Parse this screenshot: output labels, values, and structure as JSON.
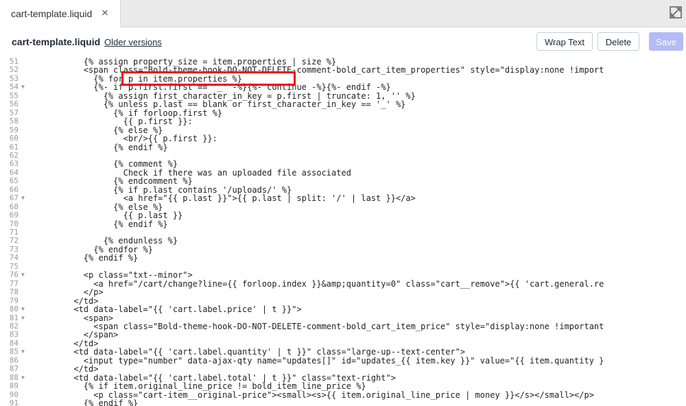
{
  "tab": {
    "label": "cart-template.liquid",
    "close": "×"
  },
  "toolbar": {
    "filename": "cart-template.liquid",
    "older_versions": "Older versions",
    "wrap_text": "Wrap Text",
    "delete": "Delete",
    "save": "Save"
  },
  "icons": {
    "close": "close-icon",
    "expand": "expand-icon",
    "fold": "fold-arrow-icon"
  },
  "colors": {
    "keyword": "#7a1ba7",
    "variable": "#1a2080",
    "string": "#1a7a1a",
    "highlight": "#e00",
    "save_disabled": "#b3bcf5"
  },
  "lines": [
    {
      "n": "51",
      "fold": false,
      "code": "        {% assign property_size = item.properties | size %}"
    },
    {
      "n": "52",
      "fold": false,
      "code": "        <span class=\"Bold-theme-hook-DO-NOT-DELETE-comment-bold_cart_item_properties\" style=\"display:none !import"
    },
    {
      "n": "53",
      "fold": false,
      "code": "          {% for p in item.properties %}"
    },
    {
      "n": "54",
      "fold": true,
      "code": "          {%- if p.first.first == '_' -%}{%- continue -%}{%- endif -%}"
    },
    {
      "n": "55",
      "fold": false,
      "code": "            {% assign first_character_in_key = p.first | truncate: 1, '' %}"
    },
    {
      "n": "56",
      "fold": false,
      "code": "            {% unless p.last == blank or first_character_in_key == '_' %}"
    },
    {
      "n": "57",
      "fold": false,
      "code": "              {% if forloop.first %}"
    },
    {
      "n": "58",
      "fold": false,
      "code": "                {{ p.first }}:"
    },
    {
      "n": "59",
      "fold": false,
      "code": "              {% else %}"
    },
    {
      "n": "60",
      "fold": false,
      "code": "                <br/>{{ p.first }}:"
    },
    {
      "n": "61",
      "fold": false,
      "code": "              {% endif %}"
    },
    {
      "n": "62",
      "fold": false,
      "code": ""
    },
    {
      "n": "63",
      "fold": false,
      "code": "              {% comment %}"
    },
    {
      "n": "64",
      "fold": false,
      "code": "                Check if there was an uploaded file associated"
    },
    {
      "n": "65",
      "fold": false,
      "code": "              {% endcomment %}"
    },
    {
      "n": "66",
      "fold": false,
      "code": "              {% if p.last contains '/uploads/' %}"
    },
    {
      "n": "67",
      "fold": true,
      "code": "                <a href=\"{{ p.last }}\">{{ p.last | split: '/' | last }}</a>"
    },
    {
      "n": "68",
      "fold": false,
      "code": "              {% else %}"
    },
    {
      "n": "69",
      "fold": false,
      "code": "                {{ p.last }}"
    },
    {
      "n": "70",
      "fold": false,
      "code": "              {% endif %}"
    },
    {
      "n": "71",
      "fold": false,
      "code": ""
    },
    {
      "n": "72",
      "fold": false,
      "code": "            {% endunless %}"
    },
    {
      "n": "73",
      "fold": false,
      "code": "          {% endfor %}"
    },
    {
      "n": "74",
      "fold": false,
      "code": "        {% endif %}"
    },
    {
      "n": "75",
      "fold": false,
      "code": ""
    },
    {
      "n": "76",
      "fold": true,
      "code": "        <p class=\"txt--minor\">"
    },
    {
      "n": "77",
      "fold": false,
      "code": "          <a href=\"/cart/change?line={{ forloop.index }}&amp;quantity=0\" class=\"cart__remove\">{{ 'cart.general.re"
    },
    {
      "n": "78",
      "fold": false,
      "code": "        </p>"
    },
    {
      "n": "79",
      "fold": false,
      "code": "      </td>"
    },
    {
      "n": "80",
      "fold": true,
      "code": "      <td data-label=\"{{ 'cart.label.price' | t }}\">"
    },
    {
      "n": "81",
      "fold": true,
      "code": "        <span>"
    },
    {
      "n": "82",
      "fold": false,
      "code": "          <span class=\"Bold-theme-hook-DO-NOT-DELETE-comment-bold_cart_item_price\" style=\"display:none !important"
    },
    {
      "n": "83",
      "fold": false,
      "code": "        </span>"
    },
    {
      "n": "84",
      "fold": false,
      "code": "      </td>"
    },
    {
      "n": "85",
      "fold": true,
      "code": "      <td data-label=\"{{ 'cart.label.quantity' | t }}\" class=\"large-up--text-center\">"
    },
    {
      "n": "86",
      "fold": false,
      "code": "        <input type=\"number\" data-ajax-qty name=\"updates[]\" id=\"updates_{{ item.key }}\" value=\"{{ item.quantity }"
    },
    {
      "n": "87",
      "fold": false,
      "code": "      </td>"
    },
    {
      "n": "88",
      "fold": true,
      "code": "      <td data-label=\"{{ 'cart.label.total' | t }}\" class=\"text-right\">"
    },
    {
      "n": "89",
      "fold": false,
      "code": "        {% if item.original_line_price != bold_item_line_price %}"
    },
    {
      "n": "90",
      "fold": false,
      "code": "          <p class=\"cart-item__original-price\"><small><s>{{ item.original_line_price | money }}</s></small></p>"
    },
    {
      "n": "91",
      "fold": false,
      "code": "        {% endif %}"
    }
  ]
}
